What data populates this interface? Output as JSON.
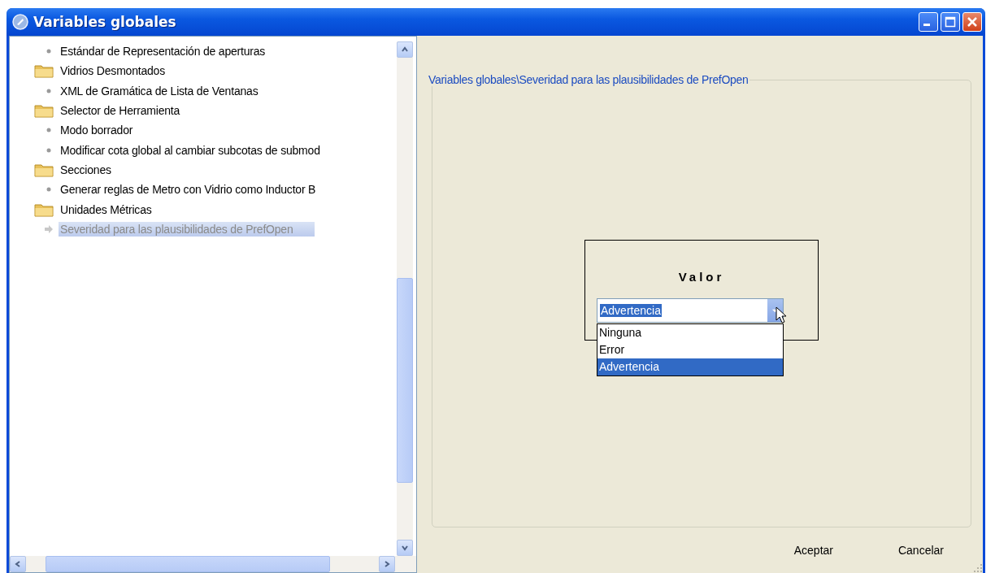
{
  "window": {
    "title": "Variables globales"
  },
  "tree": {
    "items": [
      {
        "kind": "leaf",
        "label": "Estándar de Representación de aperturas",
        "selected": false
      },
      {
        "kind": "folder",
        "label": "Vidrios Desmontados",
        "selected": false
      },
      {
        "kind": "leaf",
        "label": "XML de Gramática de Lista de Ventanas",
        "selected": false
      },
      {
        "kind": "folder",
        "label": "Selector de Herramienta",
        "selected": false
      },
      {
        "kind": "leaf",
        "label": "Modo borrador",
        "selected": false
      },
      {
        "kind": "leaf",
        "label": "Modificar cota global al cambiar subcotas de submod",
        "selected": false
      },
      {
        "kind": "folder",
        "label": "Secciones",
        "selected": false
      },
      {
        "kind": "leaf",
        "label": "Generar reglas de Metro con Vidrio como Inductor B",
        "selected": false
      },
      {
        "kind": "folder",
        "label": "Unidades Métricas",
        "selected": false
      },
      {
        "kind": "leaf",
        "label": "Severidad para las plausibilidades de PrefOpen",
        "selected": true
      }
    ]
  },
  "group": {
    "legend": "Variables globales\\Severidad para las plausibilidades de PrefOpen",
    "value_box": {
      "label": "Valor",
      "combo": {
        "value": "Advertencia",
        "expanded": true,
        "options": [
          {
            "label": "Ninguna",
            "selected": false
          },
          {
            "label": "Error",
            "selected": false
          },
          {
            "label": "Advertencia",
            "selected": true
          }
        ]
      }
    }
  },
  "buttons": [
    "Aceptar",
    "Cancelar"
  ]
}
